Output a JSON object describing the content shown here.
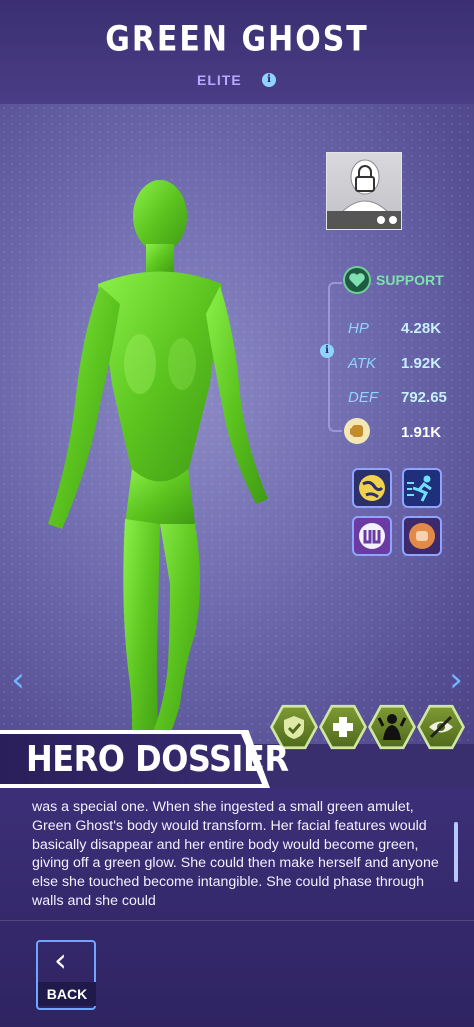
{
  "header": {
    "hero_name": "GREEN GHOST",
    "rank": "ELITE",
    "info_icon": "info-icon"
  },
  "hero_card": {
    "avatar_icon": "locked-avatar-icon",
    "role": "SUPPORT",
    "role_icon": "heart-shield-icon",
    "stats": [
      {
        "name": "HP",
        "value": "4.28K"
      },
      {
        "name": "ATK",
        "value": "1.92K"
      },
      {
        "name": "DEF",
        "value": "792.65"
      }
    ],
    "power_icon": "fist-icon",
    "power": "1.91K"
  },
  "skills": [
    "globe-icon",
    "running-icon",
    "logo-badge-icon",
    "punch-icon"
  ],
  "traits": [
    "shield-check-icon",
    "plus-icon",
    "dark-figure-icon",
    "eye-slash-icon"
  ],
  "nav": {
    "prev_icon": "chevron-left-icon",
    "next_icon": "chevron-right-icon"
  },
  "dossier": {
    "title": "HERO DOSSIER",
    "text": "was a special one. When she ingested a small green amulet, Green Ghost's body would transform. Her facial features would basically disappear and her entire body would become green, giving off a green glow. She could then make herself and anyone else she touched become intangible. She could phase through walls and she could"
  },
  "back": {
    "label": "BACK"
  },
  "colors": {
    "accent_blue": "#6fa6ff",
    "stat_blue": "#8fd3ff",
    "support_green": "#7fe0b0",
    "figure_green": "#6fd42a"
  }
}
